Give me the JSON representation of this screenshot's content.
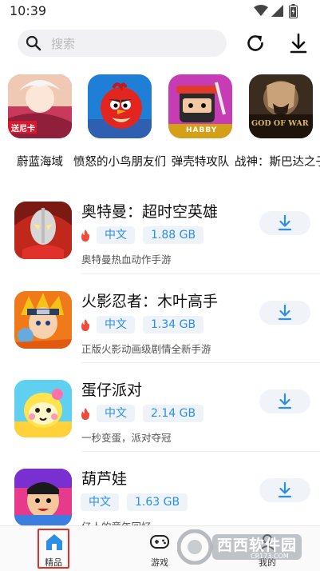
{
  "status": {
    "time": "10:39"
  },
  "search": {
    "placeholder": "搜索"
  },
  "featured": [
    {
      "label": "蔚蓝海域",
      "icon": "anime-pirate-icon",
      "badge": "送尼卡"
    },
    {
      "label": "愤怒的小鸟朋友们",
      "icon": "angry-bird-icon"
    },
    {
      "label": "弹壳特攻队",
      "icon": "habby-warrior-icon",
      "badge": "HABBY"
    },
    {
      "label": "战神：斯巴达之子",
      "icon": "god-of-war-icon",
      "badge": "GOD OF WAR"
    }
  ],
  "apps": [
    {
      "title": "奥特曼：超时空英雄",
      "lang": "中文",
      "size": "1.88 GB",
      "desc": "奥特曼热血动作手游",
      "hot": true,
      "icon": "ultraman-icon"
    },
    {
      "title": "火影忍者：木叶高手",
      "lang": "中文",
      "size": "1.34 GB",
      "desc": "正版火影动画级剧情全新手游",
      "hot": true,
      "icon": "naruto-icon"
    },
    {
      "title": "蛋仔派对",
      "lang": "中文",
      "size": "2.14 GB",
      "desc": "一秒变蛋，派对夺冠",
      "hot": true,
      "icon": "eggy-party-icon"
    },
    {
      "title": "葫芦娃",
      "lang": "中文",
      "size": "1.63 GB",
      "desc": "亿人的童年回忆",
      "hot": false,
      "icon": "calabash-brothers-icon"
    }
  ],
  "nav": [
    {
      "label": "精品",
      "icon": "home-icon",
      "selected": true
    },
    {
      "label": "游戏",
      "icon": "gamepad-icon",
      "selected": false
    },
    {
      "label": "我的",
      "icon": "profile-icon",
      "selected": false
    }
  ],
  "watermark": {
    "text": "西西软件园",
    "sub": "CR173.COM"
  },
  "colors": {
    "accent": "#2a8fe5",
    "hot": "#f04a3a",
    "selected_frame": "#e0322b"
  }
}
